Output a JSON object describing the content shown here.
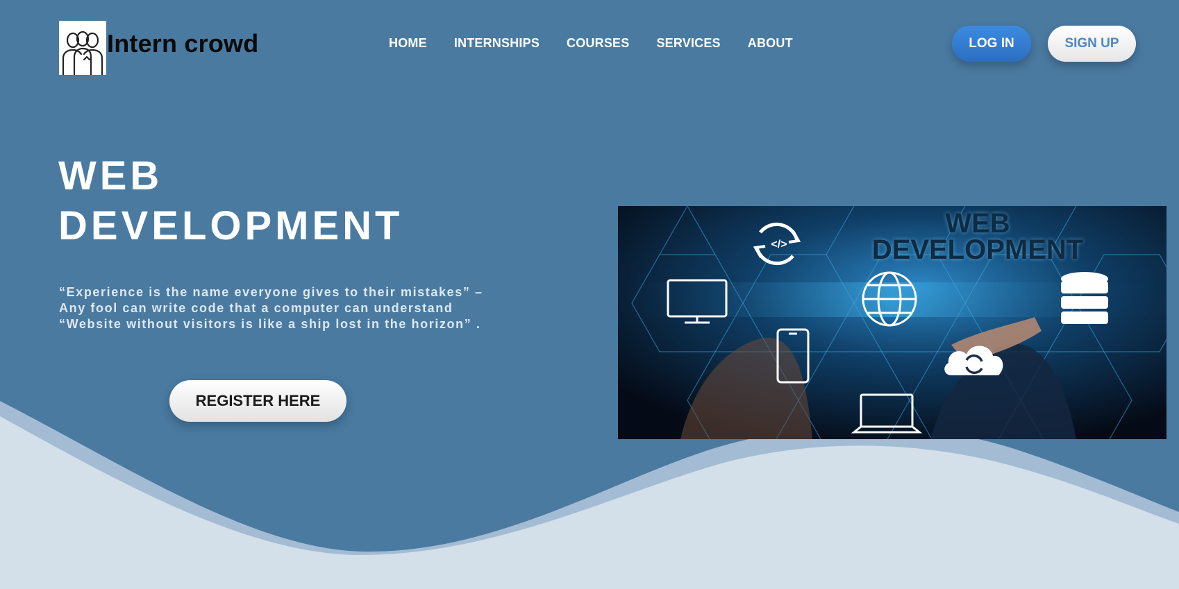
{
  "brand": {
    "name": "Intern crowd",
    "logo_icon": "team-people-icon"
  },
  "nav": {
    "items": [
      {
        "label": "HOME"
      },
      {
        "label": "INTERNSHIPS"
      },
      {
        "label": "COURSES"
      },
      {
        "label": "SERVICES"
      },
      {
        "label": "ABOUT"
      }
    ]
  },
  "auth": {
    "login_label": "LOG IN",
    "signup_label": "SIGN UP"
  },
  "hero": {
    "title_line1": "WEB",
    "title_line2": "DEVELOPMENT",
    "quotes": [
      "“Experience is the name everyone gives to their mistakes” –",
      "Any fool can write code that a computer can understand",
      "“Website without visitors is like a ship lost in the horizon” ."
    ],
    "register_label": "REGISTER HERE",
    "image": {
      "title_line1": "WEB",
      "title_line2": "DEVELOPMENT",
      "icons": [
        "code-sync-icon",
        "monitor-icon",
        "globe-icon",
        "database-icon",
        "smartphone-icon",
        "cloud-sync-icon",
        "laptop-icon"
      ]
    }
  },
  "colors": {
    "background": "#4a7aa0",
    "wave_light": "#d4e0e9",
    "wave_mid": "#a3bcd3",
    "login_button": "#2f74c8",
    "signup_text": "#4f86c6"
  }
}
